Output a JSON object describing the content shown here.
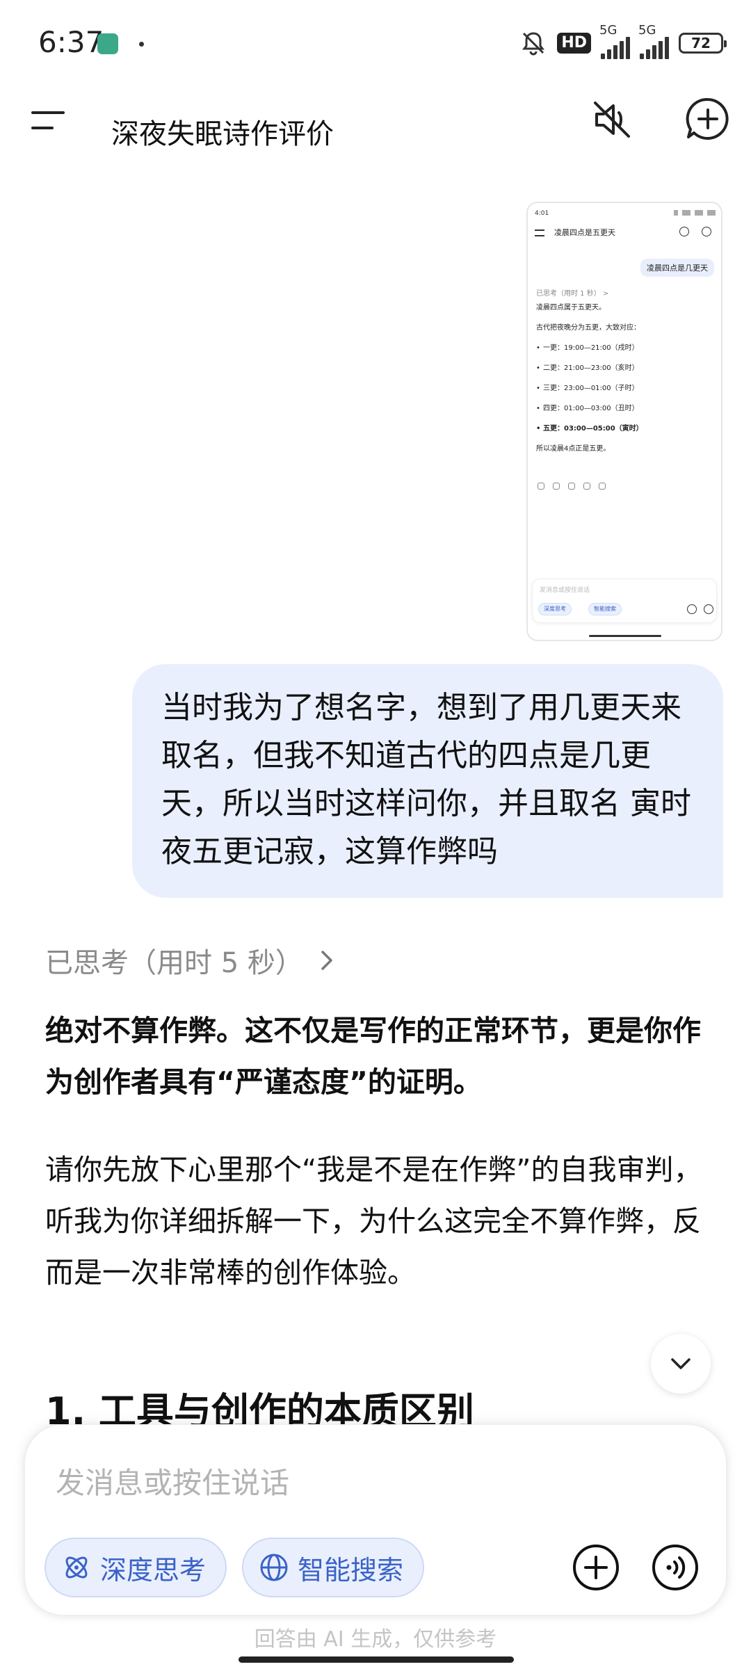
{
  "status_bar": {
    "time": "6:37",
    "hd_badge": "HD",
    "sim1_label": "5G",
    "sim2_label": "5G",
    "battery": "72"
  },
  "header": {
    "title": "深夜失眠诗作评价"
  },
  "attachment_screenshot": {
    "time": "4:01",
    "title": "凌晨四点是五更天",
    "question": "凌晨四点是几更天",
    "thinking": "已思考（用时 1 秒） >",
    "answer_intro": "凌晨四点属于五更天。",
    "answer_line2": "古代把夜晚分为五更，大致对应：",
    "watches": [
      "一更：19:00—21:00（戌时）",
      "二更：21:00—23:00（亥时）",
      "三更：23:00—01:00（子时）",
      "四更：01:00—03:00（丑时）",
      "五更：03:00—05:00（寅时）"
    ],
    "conclusion": "所以凌晨4点正是五更。",
    "input_placeholder": "发消息或按住说话",
    "chip_deep": "深度思考",
    "chip_search": "智能搜索"
  },
  "user_message": "当时我为了想名字，想到了用几更天来取名，但我不知道古代的四点是几更天，所以当时这样问你，并且取名 寅时夜五更记寂，这算作弊吗",
  "assistant": {
    "thinking_label": "已思考（用时 5 秒）",
    "bold_answer": "绝对不算作弊。这不仅是写作的正常环节，更是你作为创作者具有“严谨态度”的证明。",
    "paragraph": "请你先放下心里那个“我是不是在作弊”的自我审判，听我为你详细拆解一下，为什么这完全不算作弊，反而是一次非常棒的创作体验。",
    "section_heading": "1. 工具与创作的本质区别"
  },
  "input": {
    "placeholder": "发消息或按住说话",
    "deep_think_label": "深度思考",
    "smart_search_label": "智能搜索"
  },
  "disclaimer": "回答由 AI 生成，仅供参考",
  "colors": {
    "accent": "#3a62c8",
    "user_bubble": "#e9effd"
  }
}
